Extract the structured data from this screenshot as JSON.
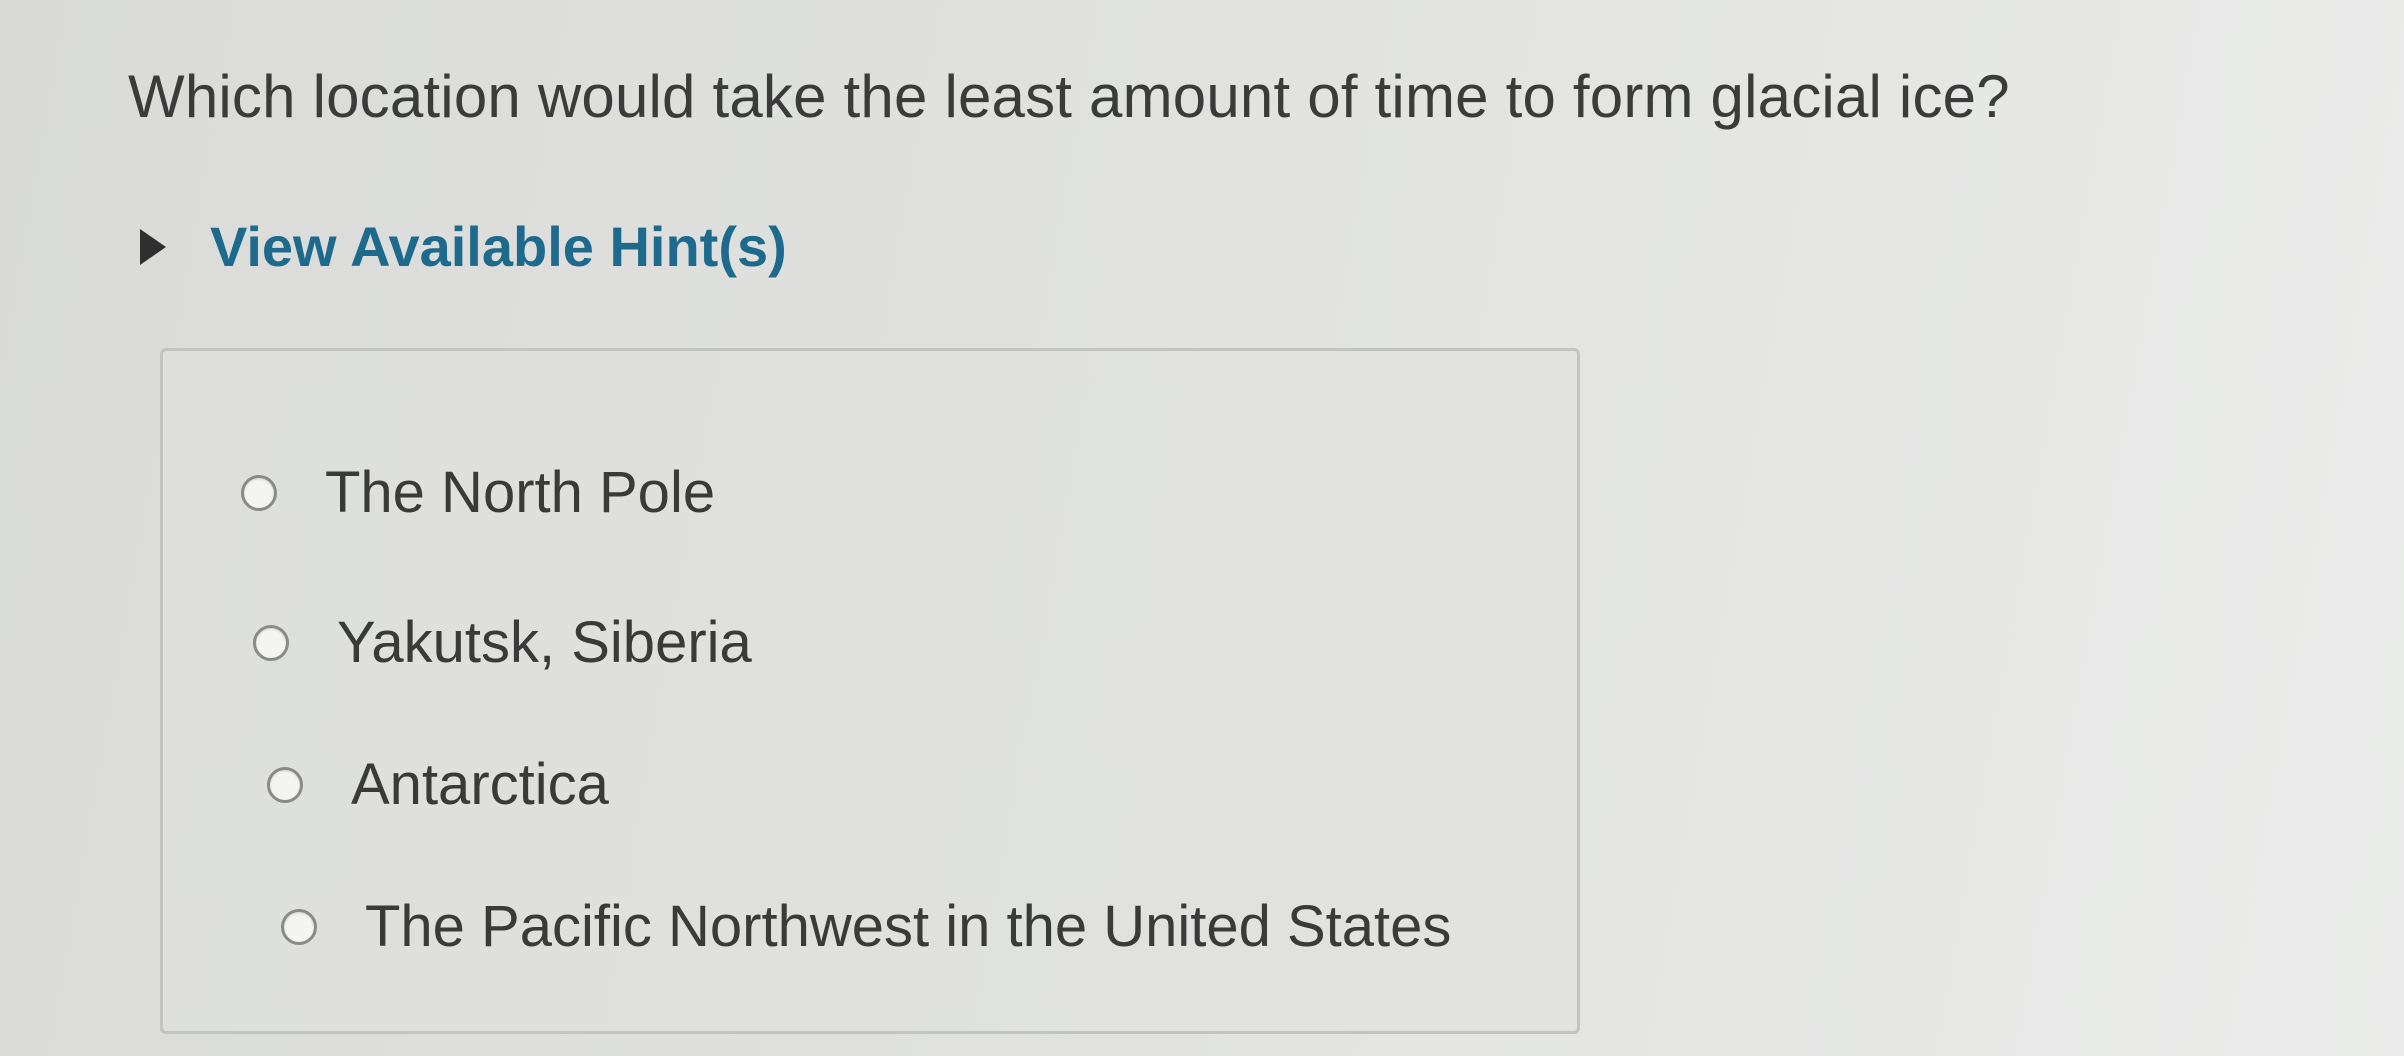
{
  "question": {
    "text": "Which location would take the least amount of time to form glacial ice?"
  },
  "hint": {
    "icon": "caret-right-icon",
    "label": "View Available Hint(s)",
    "link_color": "#1e6a8c"
  },
  "choices": [
    {
      "label": "The North Pole",
      "selected": false
    },
    {
      "label": "Yakutsk, Siberia",
      "selected": false
    },
    {
      "label": "Antarctica",
      "selected": false
    },
    {
      "label": "The Pacific Northwest in the United States",
      "selected": false
    }
  ]
}
